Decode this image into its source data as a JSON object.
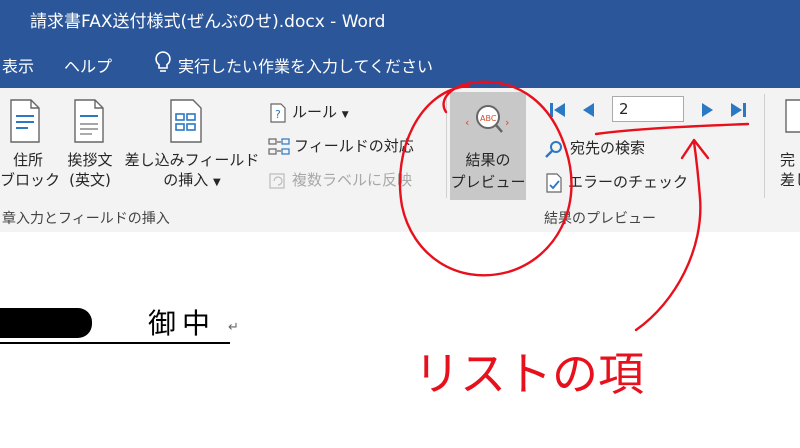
{
  "titlebar": {
    "title": "請求書FAX送付様式(ぜんぶのせ).docx  -  Word"
  },
  "menu": {
    "view": "表示",
    "help": "ヘルプ",
    "tell_me": "実行したい作業を入力してください"
  },
  "ribbon": {
    "address_block": [
      "住所",
      "ブロック"
    ],
    "greeting_line": [
      "挨拶文",
      "(英文)"
    ],
    "insert_merge_field": [
      "差し込みフィールド",
      "の挿入"
    ],
    "rules": "ルール",
    "match_fields": "フィールドの対応",
    "update_labels": "複数ラベルに反映",
    "group_write_insert": "章入力とフィールドの挿入",
    "preview_results": [
      "結果の",
      "プレビュー"
    ],
    "preview_icon_text": "ABC",
    "record_number": "2",
    "find_recipient": "宛先の検索",
    "check_errors": "エラーのチェック",
    "group_preview": "結果のプレビュー",
    "finish_partial": [
      "完",
      "差し"
    ]
  },
  "document": {
    "heading_text": "御中",
    "para_mark": "↵"
  },
  "annotation": {
    "handwritten_text": "リストの項"
  },
  "colors": {
    "word_blue": "#2b579a",
    "nav_arrow": "#2b78c5",
    "annotation_red": "#e8101c"
  }
}
